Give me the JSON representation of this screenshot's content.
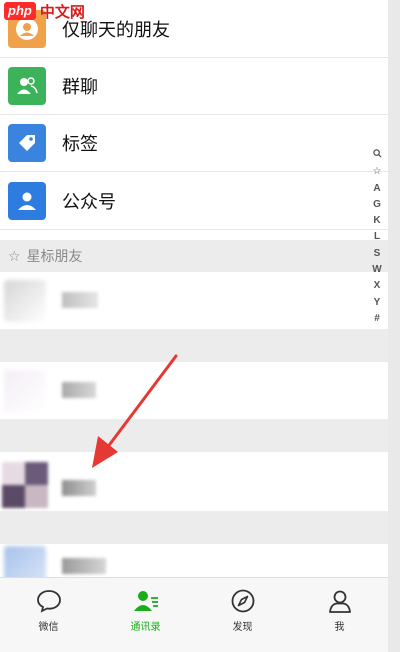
{
  "watermark": {
    "logo": "php",
    "text": "中文网"
  },
  "features": [
    {
      "label": "仅聊天的朋友",
      "color": "#f0a24a",
      "icon": "chat-friend-icon"
    },
    {
      "label": "群聊",
      "color": "#3cb35b",
      "icon": "group-chat-icon"
    },
    {
      "label": "标签",
      "color": "#3a84e0",
      "icon": "tag-icon"
    },
    {
      "label": "公众号",
      "color": "#2f7ce0",
      "icon": "official-account-icon"
    }
  ],
  "starred": {
    "label": "星标朋友"
  },
  "index_letters": [
    "☆",
    "A",
    "G",
    "K",
    "L",
    "S",
    "W",
    "X",
    "Y",
    "#"
  ],
  "index_search": "search-icon",
  "tabs": [
    {
      "label": "微信",
      "icon": "chat-bubble-icon",
      "active": false
    },
    {
      "label": "通讯录",
      "icon": "contacts-icon",
      "active": true
    },
    {
      "label": "发现",
      "icon": "compass-icon",
      "active": false
    },
    {
      "label": "我",
      "icon": "person-icon",
      "active": false
    }
  ],
  "colors": {
    "active_tab": "#1aad19",
    "section_bg": "#ececec",
    "annotation_arrow": "#e53935"
  }
}
